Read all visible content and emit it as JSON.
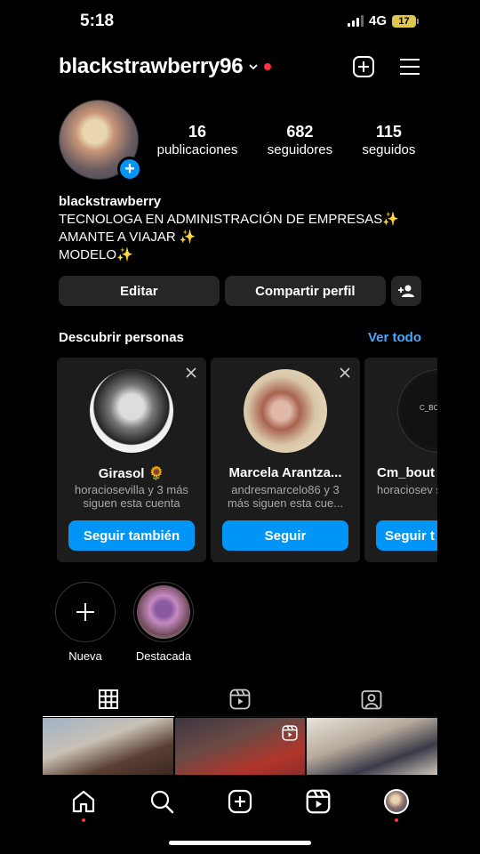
{
  "status_bar": {
    "time": "5:18",
    "network": "4G",
    "battery": "17"
  },
  "header": {
    "username": "blackstrawberry96"
  },
  "profile": {
    "stats": [
      {
        "value": "16",
        "label": "publicaciones"
      },
      {
        "value": "682",
        "label": "seguidores"
      },
      {
        "value": "115",
        "label": "seguidos"
      }
    ],
    "name": "blackstrawberry",
    "bio_lines": [
      "TECNOLOGA EN ADMINISTRACIÓN DE EMPRESAS✨",
      "AMANTE A VIAJAR ✨",
      "MODELO✨"
    ]
  },
  "actions": {
    "edit_label": "Editar",
    "share_label": "Compartir perfil"
  },
  "discover": {
    "title": "Descubrir personas",
    "see_all": "Ver todo",
    "cards": [
      {
        "name": "Girasol 🌻",
        "sub": "horaciosevilla y 3 más siguen esta cuenta",
        "button": "Seguir también"
      },
      {
        "name": "Marcela Arantza...",
        "sub": "andresmarcelo86 y 3 más siguen esta cue...",
        "button": "Seguir"
      },
      {
        "name": "Cm_bout",
        "sub": "horaciosev siguen es",
        "button": "Seguir t",
        "logo_text": "C_BOU"
      }
    ]
  },
  "highlights": [
    {
      "label": "Nueva"
    },
    {
      "label": "Destacada"
    }
  ],
  "colors": {
    "accent": "#0095f6",
    "link": "#4aa8ff",
    "notification": "#ff3040",
    "button_gray": "#262626",
    "card_bg": "#1c1c1c"
  },
  "icons": {
    "header": [
      "chevron-down-icon",
      "new-post-icon",
      "menu-icon"
    ],
    "tabs": [
      "grid-icon",
      "reels-icon",
      "tagged-icon"
    ],
    "nav": [
      "home-icon",
      "search-icon",
      "create-icon",
      "reels-icon",
      "profile-avatar"
    ]
  }
}
